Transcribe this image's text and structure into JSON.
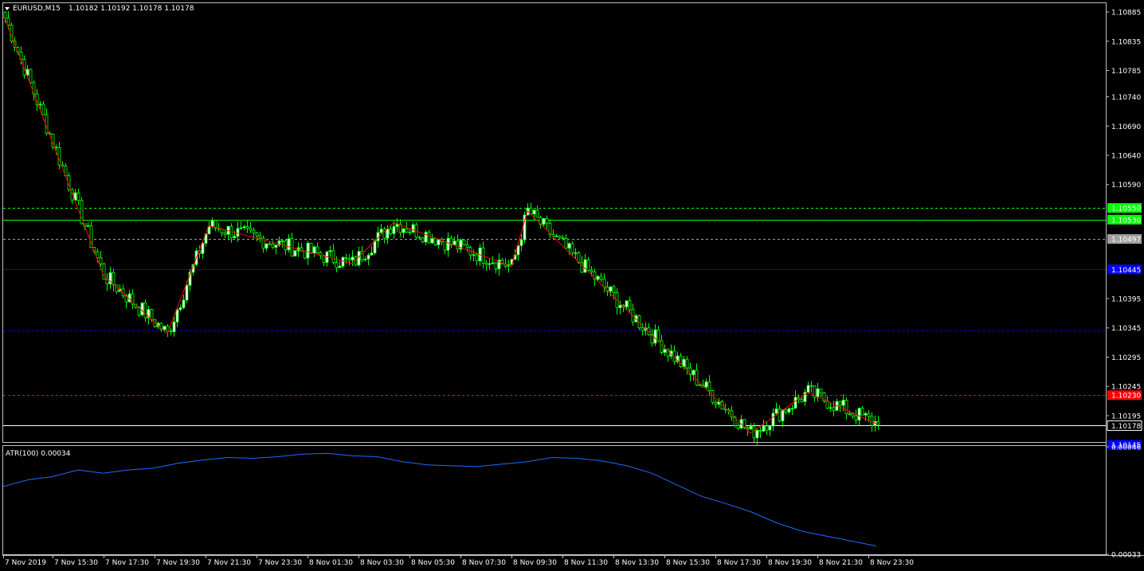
{
  "header": {
    "symbol_label": "EURUSD,M15",
    "ohlc_label": "1.10182 1.10192 1.10178 1.10178"
  },
  "indicator": {
    "label": "ATR(100) 0.00034"
  },
  "colors": {
    "background": "#000000",
    "frame": "#c0c0c0",
    "candle_up_body": "#ffffff",
    "candle_down_body": "#000000",
    "candle_outline": "#00ff00",
    "zigzag": "#ff0000",
    "atr_line": "#1e6bff",
    "green_level": "#00ff00",
    "blue_level": "#0000ff",
    "red_level": "#ff0000",
    "gray_level": "#a0a0a0"
  },
  "chart_data": [
    {
      "type": "candlestick",
      "title": "EURUSD,M15",
      "ylim": [
        1.1015,
        1.109
      ],
      "price_ticks": [
        "1.10885",
        "1.10835",
        "1.10785",
        "1.10740",
        "1.10690",
        "1.10640",
        "1.10590",
        "1.10550",
        "1.10530",
        "1.10497",
        "1.10445",
        "1.10395",
        "1.10345",
        "1.10295",
        "1.10245",
        "1.10230",
        "1.10195",
        "1.10178",
        "1.10145"
      ],
      "price_tick_values": [
        1.10885,
        1.10835,
        1.10785,
        1.1074,
        1.1069,
        1.1064,
        1.1059,
        1.1055,
        1.1053,
        1.10497,
        1.10445,
        1.10395,
        1.10345,
        1.10295,
        1.10245,
        1.1023,
        1.10195,
        1.10178,
        1.10145
      ],
      "time_labels": [
        "7 Nov 2019",
        "7 Nov 15:30",
        "7 Nov 17:30",
        "7 Nov 19:30",
        "7 Nov 21:30",
        "7 Nov 23:30",
        "8 Nov 01:30",
        "8 Nov 03:30",
        "8 Nov 05:30",
        "8 Nov 07:30",
        "8 Nov 09:30",
        "8 Nov 11:30",
        "8 Nov 13:30",
        "8 Nov 15:30",
        "8 Nov 17:30",
        "8 Nov 19:30",
        "8 Nov 21:30",
        "8 Nov 23:30"
      ],
      "levels": [
        {
          "price": 1.1055,
          "label": "1.10550",
          "color": "#00ff00",
          "style": "dashed"
        },
        {
          "price": 1.1053,
          "label": "1.10530",
          "color": "#00ff00",
          "style": "solid"
        },
        {
          "price": 1.10497,
          "label": "1.10497",
          "color": "#a0a0a0",
          "style": "dashed"
        },
        {
          "price": 1.10445,
          "label": "1.10445",
          "color": "#0000ff",
          "style": "solid"
        },
        {
          "price": 1.1034,
          "label": "1.10340",
          "color": "#0000ff",
          "style": "dashed"
        },
        {
          "price": 1.1023,
          "label": "1.10230",
          "color": "#ff0000",
          "style": "dashed"
        },
        {
          "price": 1.10178,
          "label": "1.10178",
          "color": "#ffffff",
          "style": "solid"
        },
        {
          "price": 1.10145,
          "label": "1.10145",
          "color": "#0000ff",
          "style": "dashed"
        }
      ],
      "zigzag": [
        {
          "bar": 0,
          "price": 1.10875
        },
        {
          "bar": 31,
          "price": 1.10435
        },
        {
          "bar": 51,
          "price": 1.10335
        },
        {
          "bar": 64,
          "price": 1.1052
        },
        {
          "bar": 109,
          "price": 1.10455
        },
        {
          "bar": 122,
          "price": 1.10525
        },
        {
          "bar": 159,
          "price": 1.1045
        },
        {
          "bar": 164,
          "price": 1.10545
        },
        {
          "bar": 234,
          "price": 1.10165
        },
        {
          "bar": 252,
          "price": 1.10235
        },
        {
          "bar": 274,
          "price": 1.1018
        }
      ]
    },
    {
      "type": "line",
      "title": "ATR(100) 0.00034",
      "ylim": [
        0.00033,
        0.00046
      ],
      "ticks": [
        "0.00046",
        "0.00033"
      ],
      "tick_values": [
        0.00046,
        0.00033
      ],
      "series": [
        {
          "values": [
            0.000412,
            0.00042,
            0.000424,
            0.000432,
            0.000428,
            0.000432,
            0.000434,
            0.00044,
            0.000444,
            0.000447,
            0.000446,
            0.000448,
            0.000451,
            0.000452,
            0.000449,
            0.000448,
            0.000442,
            0.000438,
            0.000437,
            0.000436,
            0.000439,
            0.000442,
            0.000447,
            0.000446,
            0.000443,
            0.000437,
            0.000428,
            0.000414,
            0.0004,
            0.000391,
            0.000381,
            0.000368,
            0.000358,
            0.000352,
            0.000346,
            0.00034
          ]
        }
      ]
    }
  ]
}
